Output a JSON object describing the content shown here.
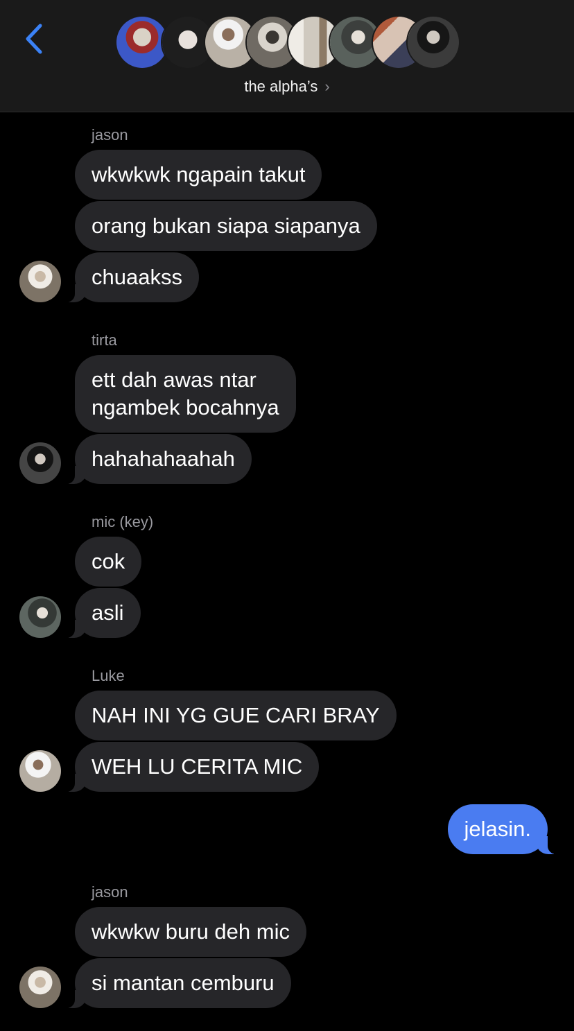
{
  "header": {
    "title": "the alpha’s",
    "title_chevron": "›",
    "back_icon": "chevron-left-icon",
    "accent": "#3b82f6",
    "member_avatars": [
      {
        "name": "member-avatar-1",
        "color": "#3c58c7"
      },
      {
        "name": "member-avatar-2",
        "color": "#2c2c2c"
      },
      {
        "name": "member-avatar-3",
        "color": "#b9b1a6"
      },
      {
        "name": "member-avatar-4",
        "color": "#6f6a63"
      },
      {
        "name": "member-avatar-5",
        "color": "#d7d3cc"
      },
      {
        "name": "member-avatar-6",
        "color": "#59615c"
      },
      {
        "name": "member-avatar-7",
        "color": "#6d5a55"
      },
      {
        "name": "member-avatar-8",
        "color": "#3b3b3b"
      }
    ]
  },
  "groups": [
    {
      "sender": "jason",
      "messages": [
        "wkwkwk ngapain takut",
        "orang bukan siapa siapanya",
        "chuaakss"
      ]
    },
    {
      "sender": "tirta",
      "messages": [
        "ett dah awas ntar\nngambek bocahnya",
        "hahahahaahah"
      ]
    },
    {
      "sender": "mic (key)",
      "messages": [
        "cok",
        "asli"
      ]
    },
    {
      "sender": "Luke",
      "messages": [
        "NAH INI YG GUE CARI BRAY",
        "WEH LU CERITA MIC"
      ]
    },
    {
      "sender": "jason",
      "messages": [
        "wkwkw buru deh mic",
        "si mantan cemburu"
      ]
    }
  ],
  "outgoing": {
    "text": "jelasin.",
    "color": "#4a7cf1"
  },
  "colors": {
    "incoming_bubble": "#262629",
    "background": "#000000",
    "sender_text": "#9a9aa0"
  }
}
